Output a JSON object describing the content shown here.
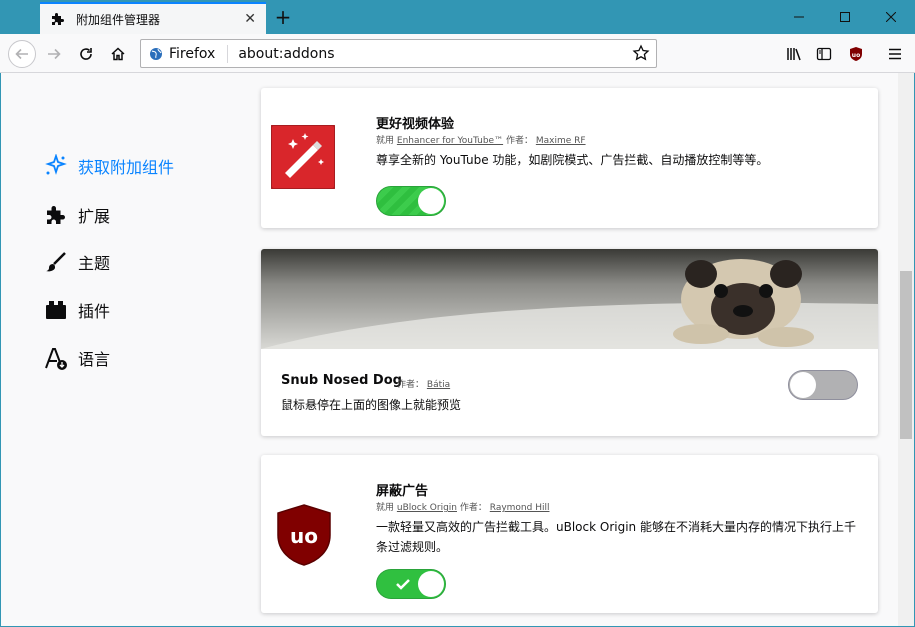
{
  "window": {
    "tab_title": "附加组件管理器",
    "url_site": "Firefox",
    "url": "about:addons"
  },
  "sidebar": {
    "items": [
      {
        "label": "获取附加组件",
        "icon": "sparkle-puzzle-icon",
        "active": true
      },
      {
        "label": "扩展",
        "icon": "puzzle-icon"
      },
      {
        "label": "主题",
        "icon": "brush-icon"
      },
      {
        "label": "插件",
        "icon": "plugin-block-icon"
      },
      {
        "label": "语言",
        "icon": "language-icon"
      }
    ]
  },
  "addons": [
    {
      "title": "更好视频体验",
      "by_prefix": "就用",
      "addon_name": "Enhancer for YouTube™",
      "author_prefix": "作者：",
      "author": "Maxime RF",
      "description": "尊享全新的 YouTube 功能，如剧院模式、广告拦截、自动播放控制等等。",
      "enabled": true,
      "icon": "magic-wand-icon"
    },
    {
      "title": "Snub Nosed Dog",
      "author_prefix": "作者：",
      "author": "Bátia",
      "description": "鼠标悬停在上面的图像上就能预览",
      "enabled": false,
      "icon": "pug-theme-image"
    },
    {
      "title": "屏蔽广告",
      "by_prefix": "就用",
      "addon_name": "uBlock Origin",
      "author_prefix": "作者：",
      "author": "Raymond Hill",
      "description_line1": "一款轻量又高效的广告拦截工具。uBlock Origin 能够在不消耗大量内存的情况下执行上千",
      "description_line2": "条过滤规则。",
      "enabled": true,
      "icon": "ublock-origin-icon"
    }
  ],
  "colors": {
    "accent": "#0a84ff",
    "titlebar": "#3296b4",
    "toggle_on": "#30c040",
    "ublock_red": "#800000"
  }
}
